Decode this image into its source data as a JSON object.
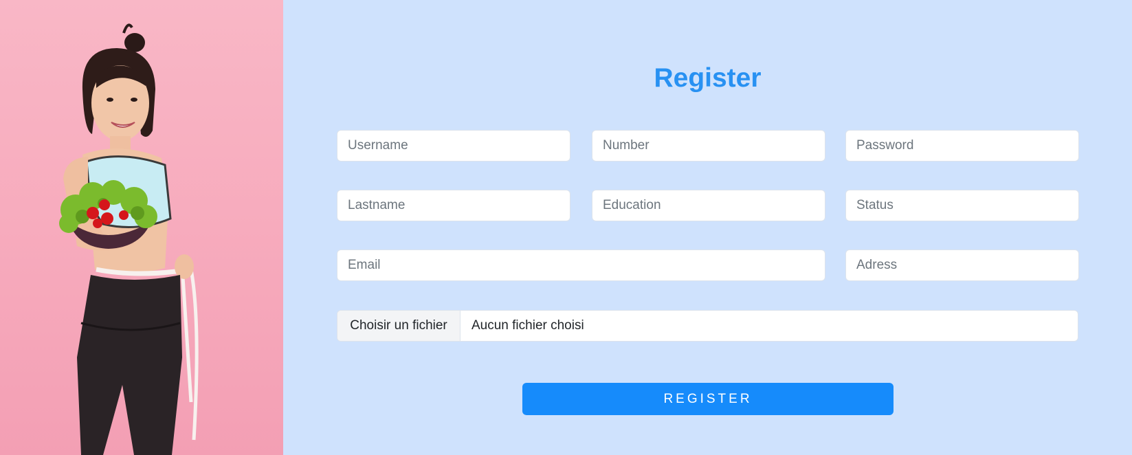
{
  "form": {
    "title": "Register",
    "fields": {
      "username": "Username",
      "number": "Number",
      "password": "Password",
      "lastname": "Lastname",
      "education": "Education",
      "status": "Status",
      "email": "Email",
      "adress": "Adress"
    },
    "file": {
      "button_label": "Choisir un fichier",
      "status_text": "Aucun fichier choisi"
    },
    "submit_label": "REGISTER"
  },
  "image": {
    "description_icon": "woman-holding-salad-photo"
  },
  "colors": {
    "accent": "#2891f2",
    "button": "#168bfb",
    "panel_bg": "#cfe2fd",
    "photo_bg": "#f9b7c6"
  }
}
